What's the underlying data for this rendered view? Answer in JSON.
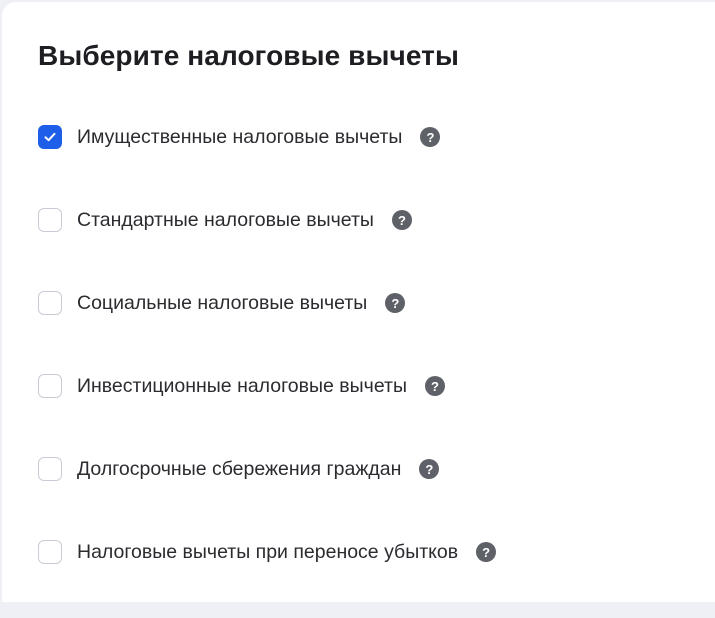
{
  "title": "Выберите налоговые вычеты",
  "options": [
    {
      "label": "Имущественные налоговые вычеты",
      "checked": true
    },
    {
      "label": "Стандартные налоговые вычеты",
      "checked": false
    },
    {
      "label": "Социальные налоговые вычеты",
      "checked": false
    },
    {
      "label": "Инвестиционные налоговые вычеты",
      "checked": false
    },
    {
      "label": "Долгосрочные сбережения граждан",
      "checked": false
    },
    {
      "label": "Налоговые вычеты при переносе убытков",
      "checked": false
    }
  ],
  "help_glyph": "?",
  "icons": {
    "checked": "checkmark-icon",
    "help": "question-circle-icon"
  },
  "colors": {
    "accent": "#1f5ee8",
    "help_icon": "#5f6168",
    "text": "#2b2b30"
  }
}
